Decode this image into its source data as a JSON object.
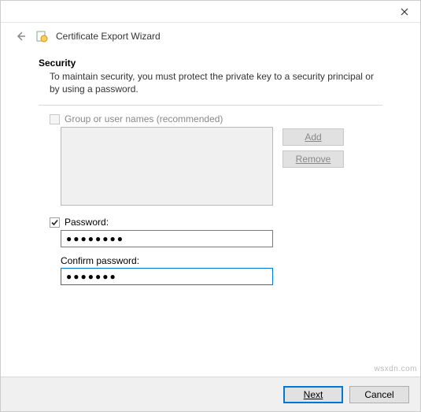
{
  "window": {
    "title": "Certificate Export Wizard"
  },
  "section": {
    "heading": "Security",
    "description": "To maintain security, you must protect the private key to a security principal or by using a password."
  },
  "group_option": {
    "label": "Group or user names (recommended)",
    "checked": false,
    "enabled": false
  },
  "buttons": {
    "add": "Add",
    "remove": "Remove"
  },
  "password_option": {
    "label": "Password:",
    "checked": true,
    "value": "●●●●●●●●"
  },
  "confirm": {
    "label": "Confirm password:",
    "value": "●●●●●●●"
  },
  "footer": {
    "next": "Next",
    "cancel": "Cancel"
  },
  "watermark": "wsxdn.com"
}
